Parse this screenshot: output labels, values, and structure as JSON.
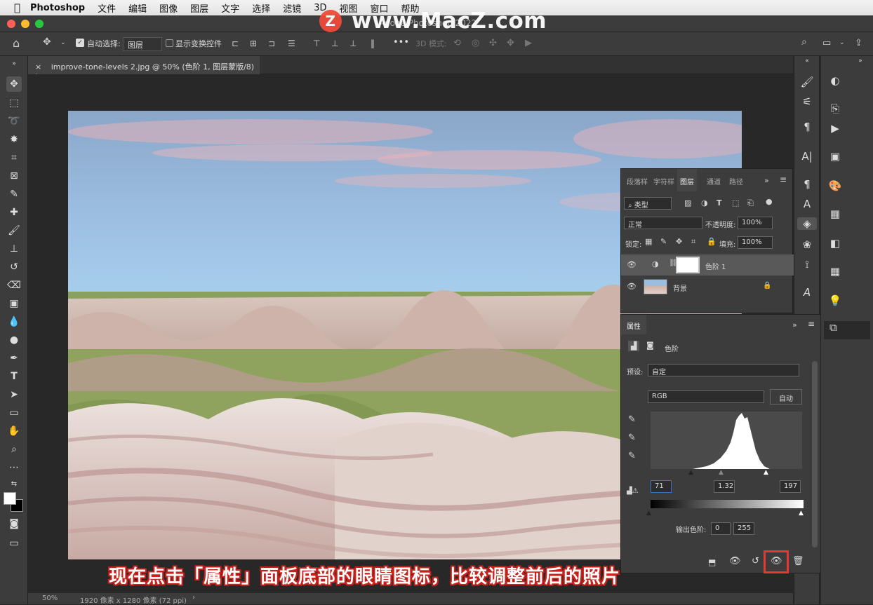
{
  "menubar": {
    "apple_icon": "apple-logo-icon",
    "app_name": "Photoshop",
    "items": [
      "文件",
      "编辑",
      "图像",
      "图层",
      "文字",
      "选择",
      "滤镜",
      "3D",
      "视图",
      "窗口",
      "帮助"
    ]
  },
  "window": {
    "title": "Adobe Photoshop 2022"
  },
  "watermark": {
    "badge": "Z",
    "text": "www.MacZ.com"
  },
  "options_bar": {
    "auto_select_label": "自动选择:",
    "auto_select_value": "图层",
    "show_transform_label": "显示变换控件",
    "mode_3d_label": "3D 模式:",
    "more": "•••"
  },
  "document": {
    "tab_close": "×",
    "tab_title": "improve-tone-levels 2.jpg @ 50% (色阶 1, 图层蒙版/8) *",
    "zoom": "50%",
    "info": "1920 像素 x 1280 像素 (72 ppi)",
    "info_arrow": "›"
  },
  "layers_panel": {
    "tabs": [
      "段落样",
      "字符样",
      "图层",
      "通道",
      "路径"
    ],
    "active_tab": "图层",
    "filter_type": "类型",
    "blend_mode": "正常",
    "opacity_label": "不透明度:",
    "opacity_value": "100%",
    "lock_label": "锁定:",
    "fill_label": "填充:",
    "fill_value": "100%",
    "layers": [
      {
        "name": "色阶 1",
        "selected": true
      },
      {
        "name": "背景",
        "selected": false
      }
    ]
  },
  "properties_panel": {
    "tab": "属性",
    "title": "色阶",
    "preset_label": "预设:",
    "preset_value": "自定",
    "channel": "RGB",
    "auto_button": "自动",
    "input_black": "71",
    "input_gamma": "1.32",
    "input_white": "197",
    "output_label": "输出色阶:",
    "output_black": "0",
    "output_white": "255"
  },
  "caption": "现在点击「属性」面板底部的眼睛图标，比较调整前后的照片",
  "colors": {
    "accent_highlight": "#e23a2e",
    "panel_bg": "#3c3c3c",
    "canvas_bg": "#282828"
  }
}
